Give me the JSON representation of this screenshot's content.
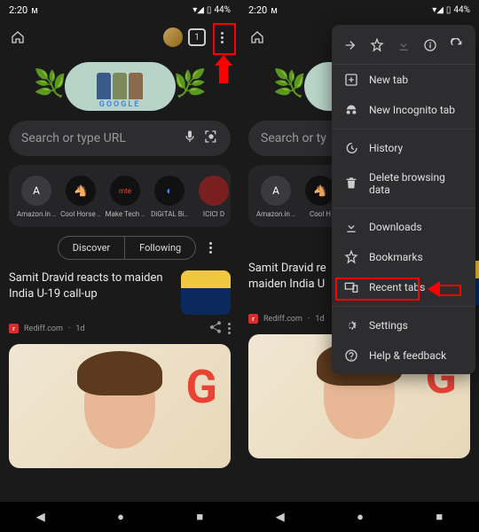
{
  "status": {
    "time": "2:20",
    "battery": "44%"
  },
  "browser": {
    "tab_count": "1"
  },
  "search": {
    "placeholder": "Search or type URL"
  },
  "doodle": {
    "brand": "GOOGLE"
  },
  "shortcuts": [
    {
      "label": "Amazon.in ..",
      "glyph": "A",
      "bg": "#3a3a3d"
    },
    {
      "label": "Cool Horse ..",
      "glyph": "🐴",
      "bg": "#111"
    },
    {
      "label": "Make Tech ..",
      "glyph": "mte",
      "bg": "#111"
    },
    {
      "label": "DiGiTAL Bi..",
      "glyph": "◐",
      "bg": "#111"
    },
    {
      "label": "ICICI D",
      "glyph": "•",
      "bg": "#7a1f1f"
    }
  ],
  "feed_tabs": {
    "discover": "Discover",
    "following": "Following"
  },
  "article": {
    "title": "Samit Dravid reacts to maiden India U-19 call-up",
    "title_short": "Samit Dravid re… maiden India U…",
    "source": "Rediff.com",
    "time": "1d",
    "source_initial": "r"
  },
  "menu": {
    "new_tab": "New tab",
    "incognito": "New Incognito tab",
    "history": "History",
    "delete_data": "Delete browsing data",
    "downloads": "Downloads",
    "bookmarks": "Bookmarks",
    "recent_tabs": "Recent tabs",
    "settings": "Settings",
    "help": "Help & feedback"
  }
}
